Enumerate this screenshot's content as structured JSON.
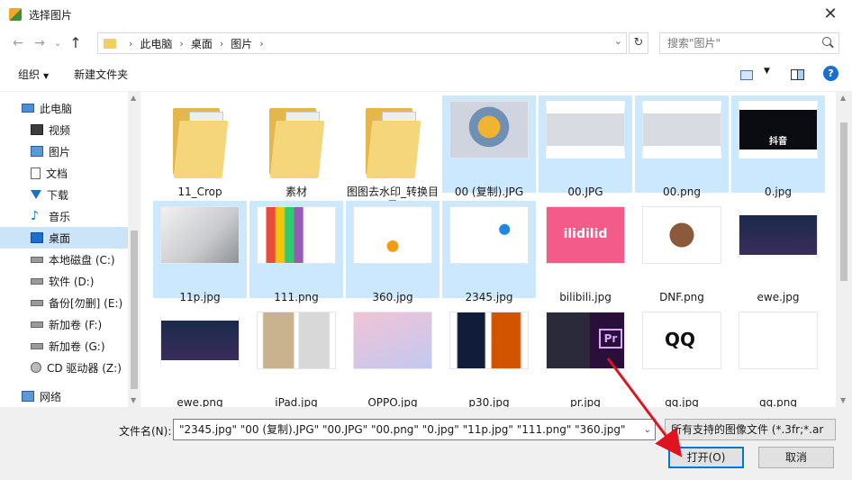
{
  "window": {
    "title": "选择图片",
    "close_glyph": "✕"
  },
  "nav": {
    "back_glyph": "←",
    "forward_glyph": "→",
    "dropdown_glyph": "⌄",
    "up_glyph": "↑",
    "breadcrumbs": [
      "此电脑",
      "桌面",
      "图片"
    ],
    "crumb_sep": "›",
    "refresh_glyph": "↻",
    "search_placeholder": "搜索\"图片\""
  },
  "toolbar": {
    "organize_label": "组织",
    "caret": "▼",
    "new_folder_label": "新建文件夹",
    "help_glyph": "?"
  },
  "sidebar": {
    "items": [
      {
        "label": "此电脑",
        "icon": "pc-icon"
      },
      {
        "label": "视频",
        "icon": "video-icon"
      },
      {
        "label": "图片",
        "icon": "picture-icon"
      },
      {
        "label": "文档",
        "icon": "document-icon"
      },
      {
        "label": "下载",
        "icon": "download-icon"
      },
      {
        "label": "音乐",
        "icon": "music-icon"
      },
      {
        "label": "桌面",
        "icon": "desktop-icon",
        "selected": true
      },
      {
        "label": "本地磁盘 (C:)",
        "icon": "drive-icon"
      },
      {
        "label": "软件 (D:)",
        "icon": "drive-icon"
      },
      {
        "label": "备份[勿删] (E:)",
        "icon": "drive-icon"
      },
      {
        "label": "新加卷 (F:)",
        "icon": "drive-icon"
      },
      {
        "label": "新加卷 (G:)",
        "icon": "drive-icon"
      },
      {
        "label": "CD 驱动器 (Z:)",
        "icon": "cd-drive-icon"
      },
      {
        "label": "网络",
        "icon": "network-icon"
      }
    ]
  },
  "files": [
    {
      "name": "11_Crop",
      "kind": "folder",
      "selected": false
    },
    {
      "name": "素材",
      "kind": "folder",
      "selected": false
    },
    {
      "name": "图图去水印_转换目录",
      "kind": "folder",
      "selected": false
    },
    {
      "name": "00 (复制).JPG",
      "kind": "image",
      "selected": true
    },
    {
      "name": "00.JPG",
      "kind": "image",
      "selected": true
    },
    {
      "name": "00.png",
      "kind": "image",
      "selected": true
    },
    {
      "name": "0.jpg",
      "kind": "image",
      "selected": true
    },
    {
      "name": "11p.jpg",
      "kind": "image",
      "selected": true
    },
    {
      "name": "111.png",
      "kind": "image",
      "selected": true
    },
    {
      "name": "360.jpg",
      "kind": "image",
      "selected": true
    },
    {
      "name": "2345.jpg",
      "kind": "image",
      "selected": true
    },
    {
      "name": "bilibili.jpg",
      "kind": "image",
      "selected": false
    },
    {
      "name": "DNF.png",
      "kind": "image",
      "selected": false
    },
    {
      "name": "ewe.jpg",
      "kind": "image",
      "selected": false
    },
    {
      "name": "ewe.png",
      "kind": "image",
      "selected": false
    },
    {
      "name": "iPad.jpg",
      "kind": "image",
      "selected": false
    },
    {
      "name": "OPPO.jpg",
      "kind": "image",
      "selected": false
    },
    {
      "name": "p30.jpg",
      "kind": "image",
      "selected": false
    },
    {
      "name": "pr.jpg",
      "kind": "image",
      "selected": false
    },
    {
      "name": "qq.jpg",
      "kind": "image",
      "selected": false
    },
    {
      "name": "qq.png",
      "kind": "image",
      "selected": false
    }
  ],
  "thumb_text": {
    "tiktok": "抖音",
    "bilibili": "ilidilid",
    "pr": "Pr",
    "qq": "QQ"
  },
  "bottom": {
    "filename_label": "文件名(N):",
    "filename_value": "\"2345.jpg\" \"00 (复制).JPG\" \"00.JPG\" \"00.png\" \"0.jpg\" \"11p.jpg\" \"111.png\" \"360.jpg\"",
    "filetype_value": "所有支持的图像文件 (*.3fr;*.ar",
    "open_label": "打开(O)",
    "cancel_label": "取消",
    "dd_glyph": "⌄"
  },
  "colors": {
    "selection": "#cce8ff",
    "accent": "#0078d7",
    "arrow": "#e0141e"
  }
}
